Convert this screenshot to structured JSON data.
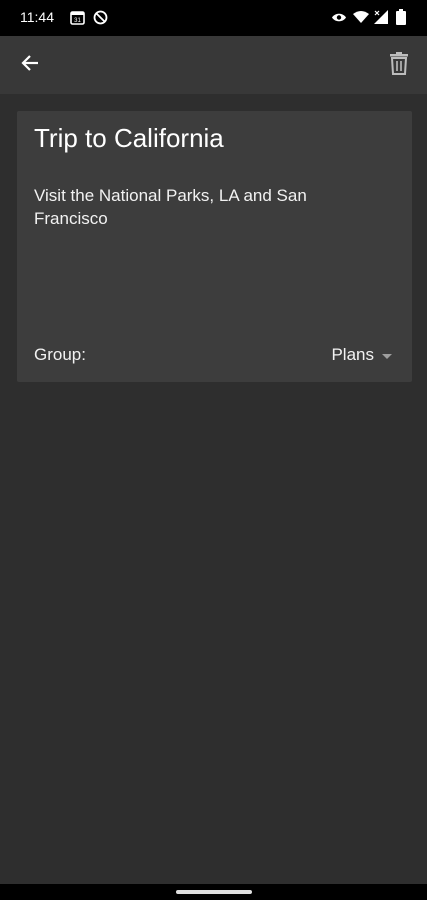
{
  "status_bar": {
    "time": "11:44",
    "icons": [
      "calendar-icon",
      "no-disturb-icon",
      "eye-icon",
      "wifi-icon",
      "signal-icon",
      "battery-icon"
    ]
  },
  "toolbar": {
    "back_icon": "arrow-left-icon",
    "delete_icon": "trash-icon"
  },
  "note": {
    "title": "Trip to California",
    "body": "Visit the National Parks, LA and San Francisco",
    "group_label": "Group:",
    "group_value": "Plans"
  },
  "colors": {
    "background": "#2e2e2e",
    "toolbar": "#383838",
    "card": "#3d3d3d",
    "status_bar": "#000000"
  }
}
